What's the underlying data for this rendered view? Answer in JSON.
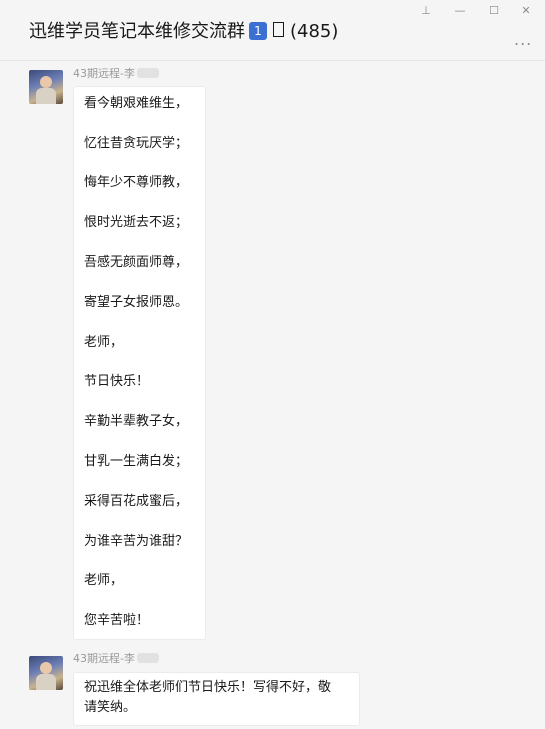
{
  "window": {
    "title": "迅维学员笔记本维修交流群",
    "badge": "1",
    "member_count": "(485)",
    "controls": {
      "pin": "⊥",
      "minimize": "—",
      "maximize": "☐",
      "close": "✕"
    },
    "more": "..."
  },
  "messages": [
    {
      "sender": "43期远程-李",
      "lines": [
        "看今朝艰难维生，",
        "忆往昔贪玩厌学；",
        "悔年少不尊师教，",
        "恨时光逝去不返；",
        "吾感无颜面师尊，",
        "寄望子女报师恩。",
        "老师，",
        "节日快乐！",
        "辛勤半辈教子女，",
        "甘乳一生满白发；",
        "采得百花成蜜后，",
        "为谁辛苦为谁甜？",
        "老师，",
        "您辛苦啦！"
      ]
    },
    {
      "sender": "43期远程-李",
      "lines": [
        "祝迅维全体老师们节日快乐！写得不好，敬",
        "请笑纳。"
      ]
    }
  ]
}
